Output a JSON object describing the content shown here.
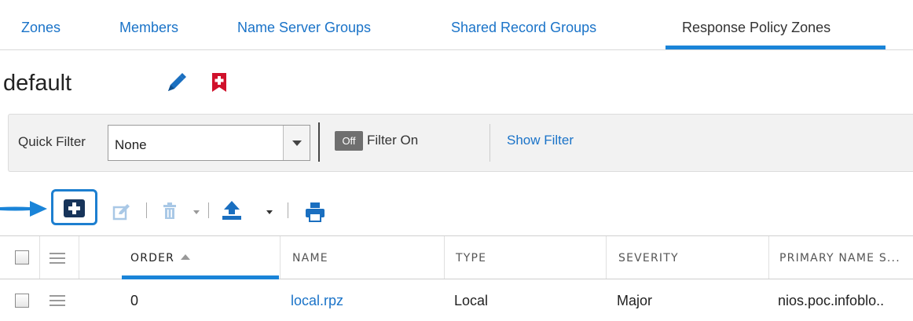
{
  "tabs": [
    {
      "label": "Zones",
      "active": false
    },
    {
      "label": "Members",
      "active": false
    },
    {
      "label": "Name Server Groups",
      "active": false
    },
    {
      "label": "Shared Record Groups",
      "active": false
    },
    {
      "label": "Response Policy Zones",
      "active": true
    }
  ],
  "page": {
    "title": "default",
    "icons": [
      "edit-icon",
      "bookmark-icon"
    ]
  },
  "filter": {
    "quick_filter_label": "Quick Filter",
    "quick_filter_value": "None",
    "toggle_label": "Off",
    "filter_on_label": "Filter On",
    "show_filter_label": "Show Filter"
  },
  "toolbar": {
    "icons": [
      "add-icon",
      "edit-icon",
      "delete-icon",
      "export-icon",
      "print-icon"
    ]
  },
  "grid": {
    "columns": [
      "ORDER",
      "NAME",
      "TYPE",
      "SEVERITY",
      "PRIMARY NAME S..."
    ],
    "sorted_column": "ORDER",
    "sort_direction": "ascending",
    "rows": [
      {
        "order": "0",
        "name": "local.rpz",
        "type": "Local",
        "severity": "Major",
        "primary_name_server": "nios.poc.infoblo.."
      }
    ]
  },
  "colors": {
    "accent": "#1a84d8",
    "link": "#1a73c8",
    "delete_bookmark_red": "#d0112b",
    "add_button_navy": "#17345a"
  }
}
